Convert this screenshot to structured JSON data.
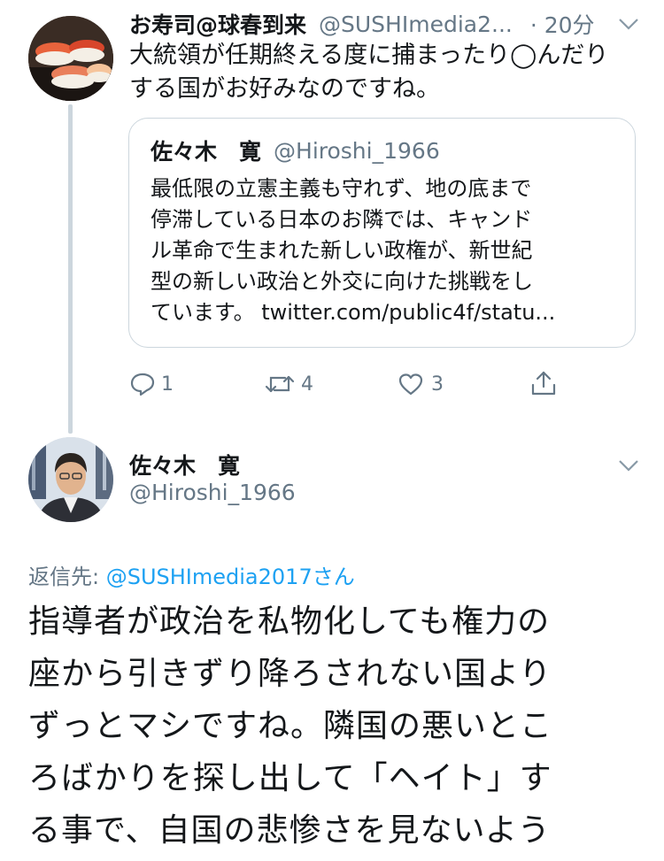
{
  "tweet1": {
    "author_name": "お寿司@球春到来",
    "author_handle": "@SUSHImedia2...",
    "time": "· 20分",
    "text_line1": "大統領が任期終える度に捕まったり◯んだり",
    "text_line2": "する国がお好みなのですね。",
    "avatar_icon": "sushi-avatar",
    "quoted": {
      "author_name": "佐々木　寛",
      "author_handle": "@Hiroshi_1966",
      "lines": [
        "最低限の立憲主義も守れず、地の底まで",
        "停滞している日本のお隣では、キャンド",
        "ル革命で生まれた新しい政権が、新世紀",
        "型の新しい政治と外交に向けた挑戦をし"
      ],
      "last_line_prefix": "ています。 ",
      "last_line_link": "twitter.com/public4f/statu..."
    },
    "actions": {
      "reply_count": "1",
      "retweet_count": "4",
      "like_count": "3"
    }
  },
  "tweet2": {
    "author_name": "佐々木　寛",
    "author_handle": "@Hiroshi_1966",
    "reply_label": "返信先: ",
    "reply_handle": "@SUSHImedia2017",
    "reply_suffix": "さん",
    "lines": [
      "指導者が政治を私物化しても権力の",
      "座から引きずり降ろされない国より",
      "ずっとマシですね。隣国の悪いとこ",
      "ろばかりを探し出して「ヘイト」す",
      "る事で、自国の悲惨さを見ないよう"
    ]
  },
  "colors": {
    "text": "#14171a",
    "secondary": "#657786",
    "link": "#1da1f2",
    "border": "#ccd6dd"
  }
}
